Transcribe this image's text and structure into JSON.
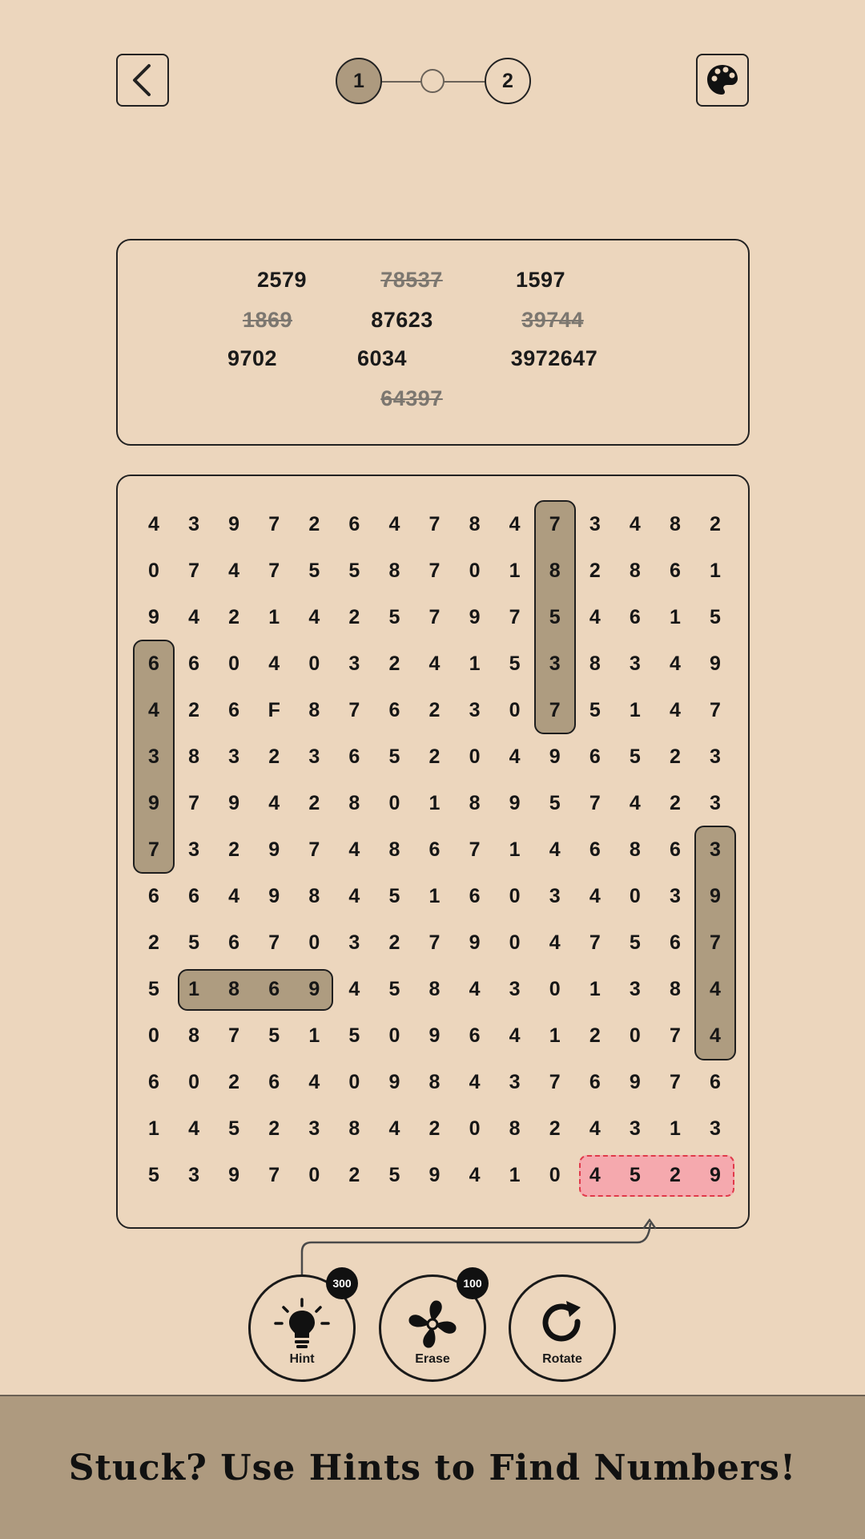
{
  "header": {
    "back_icon": "chevron-left-icon",
    "palette_icon": "palette-icon",
    "steps": [
      {
        "label": "1",
        "active": true
      },
      {
        "label": "",
        "active": false
      },
      {
        "label": "2",
        "active": false
      }
    ]
  },
  "words": [
    {
      "text": "2579",
      "found": false
    },
    {
      "text": "78537",
      "found": true
    },
    {
      "text": "1597",
      "found": false
    },
    {
      "text": "1869",
      "found": true
    },
    {
      "text": "87623",
      "found": false
    },
    {
      "text": "39744",
      "found": true
    },
    {
      "text": "9702",
      "found": false
    },
    {
      "text": "6034",
      "found": false
    },
    {
      "text": "3972647",
      "found": false
    },
    {
      "text": "64397",
      "found": true
    }
  ],
  "grid": [
    "439726478473482",
    "074755870182861",
    "942142579754615",
    "660403241538349",
    "426F87623075147",
    "383236520496523",
    "979428018957423",
    "732974867146863",
    "664984516034039",
    "256703279047567",
    "518694584301384",
    "087515096412074",
    "602640984376976",
    "145238420824313",
    "539702594104529"
  ],
  "found_highlights": [
    {
      "word": "78537",
      "row": 0,
      "col": 10,
      "dir": "v",
      "len": 5
    },
    {
      "word": "64397",
      "row": 3,
      "col": 0,
      "dir": "v",
      "len": 5
    },
    {
      "word": "39744",
      "row": 7,
      "col": 14,
      "dir": "v",
      "len": 5
    },
    {
      "word": "1869",
      "row": 10,
      "col": 1,
      "dir": "h",
      "len": 4
    }
  ],
  "hint_highlight": {
    "row": 14,
    "col": 11,
    "dir": "h",
    "len": 4
  },
  "tools": [
    {
      "label": "Hint",
      "icon": "lightbulb-icon",
      "badge": "300"
    },
    {
      "label": "Erase",
      "icon": "fan-icon",
      "badge": "100"
    },
    {
      "label": "Rotate",
      "icon": "rotate-icon",
      "badge": ""
    }
  ],
  "banner": {
    "text": "Stuck? Use Hints to Find Numbers!"
  },
  "colors": {
    "background": "#ecd6bd",
    "found_highlight": "#ae9c80",
    "hint_highlight": "#f5a9ae",
    "hint_border": "#e03a4a",
    "banner": "#ae9a7f"
  }
}
